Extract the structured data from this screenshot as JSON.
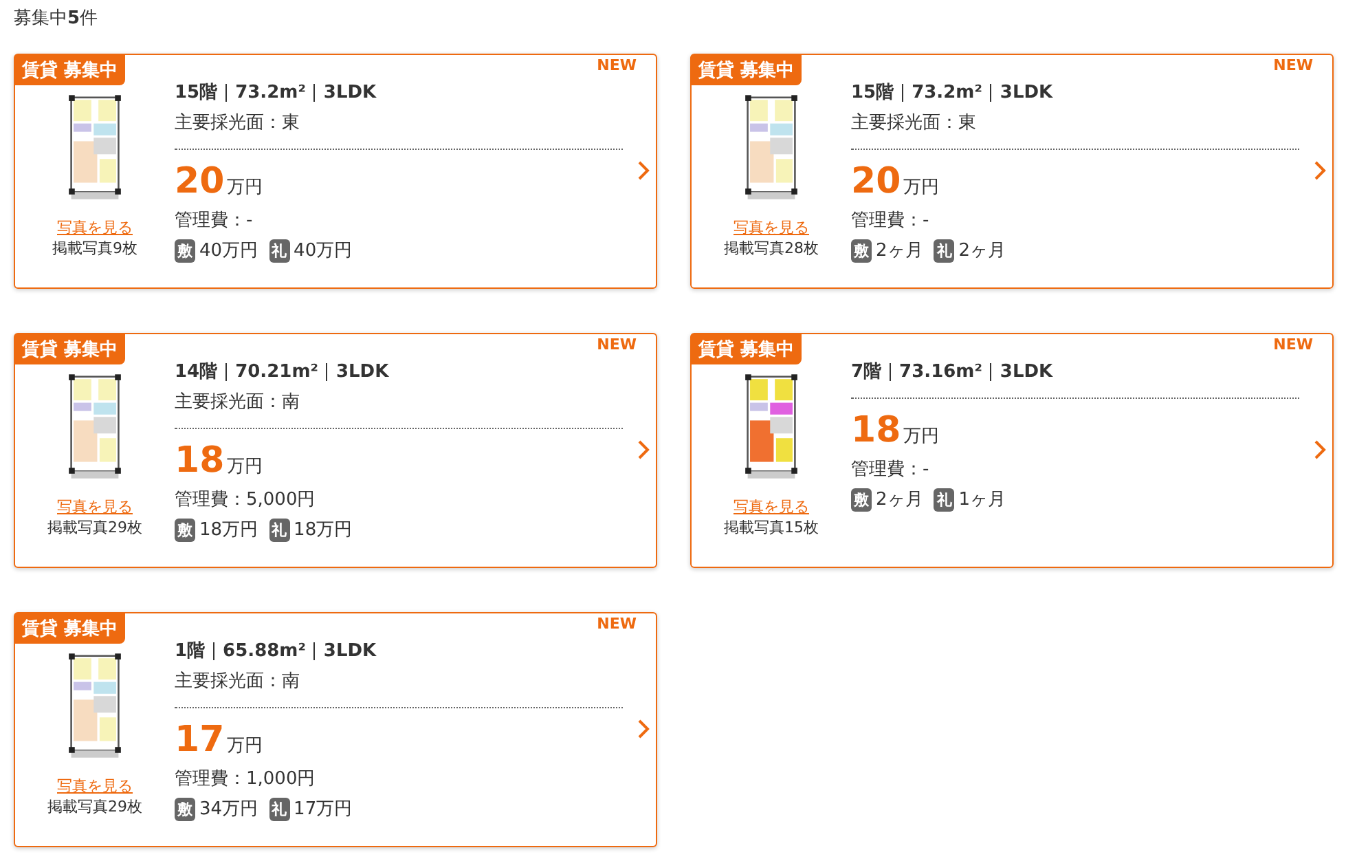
{
  "heading": "募集中**5**件",
  "listings": [
    {
      "tag": "賃貸 募集中",
      "new_label": "NEW",
      "floor": "15階",
      "area": "73.2m²",
      "layout": "3LDK",
      "lighting": "主要採光面：東",
      "rent": "20",
      "rent_unit": "万円",
      "fee": "管理費：-",
      "deposit_mark": "敷",
      "deposit": "40万円",
      "key_mark": "礼",
      "key_money": "40万円",
      "photo_link": "写真を見る",
      "photo_count": "掲載写真9枚"
    },
    {
      "tag": "賃貸 募集中",
      "new_label": "NEW",
      "floor": "15階",
      "area": "73.2m²",
      "layout": "3LDK",
      "lighting": "主要採光面：東",
      "rent": "20",
      "rent_unit": "万円",
      "fee": "管理費：-",
      "deposit_mark": "敷",
      "deposit": "2ヶ月",
      "key_mark": "礼",
      "key_money": "2ヶ月",
      "photo_link": "写真を見る",
      "photo_count": "掲載写真28枚"
    },
    {
      "tag": "賃貸 募集中",
      "new_label": "NEW",
      "floor": "14階",
      "area": "70.21m²",
      "layout": "3LDK",
      "lighting": "主要採光面：南",
      "rent": "18",
      "rent_unit": "万円",
      "fee": "管理費：5,000円",
      "deposit_mark": "敷",
      "deposit": "18万円",
      "key_mark": "礼",
      "key_money": "18万円",
      "photo_link": "写真を見る",
      "photo_count": "掲載写真29枚"
    },
    {
      "tag": "賃貸 募集中",
      "new_label": "NEW",
      "floor": "7階",
      "area": "73.16m²",
      "layout": "3LDK",
      "rent": "18",
      "rent_unit": "万円",
      "fee": "管理費：-",
      "deposit_mark": "敷",
      "deposit": "2ヶ月",
      "key_mark": "礼",
      "key_money": "1ヶ月",
      "photo_link": "写真を見る",
      "photo_count": "掲載写真15枚"
    },
    {
      "tag": "賃貸 募集中",
      "new_label": "NEW",
      "floor": "1階",
      "area": "65.88m²",
      "layout": "3LDK",
      "lighting": "主要採光面：南",
      "rent": "17",
      "rent_unit": "万円",
      "fee": "管理費：1,000円",
      "deposit_mark": "敷",
      "deposit": "34万円",
      "key_mark": "礼",
      "key_money": "17万円",
      "photo_link": "写真を見る",
      "photo_count": "掲載写真29枚"
    }
  ]
}
